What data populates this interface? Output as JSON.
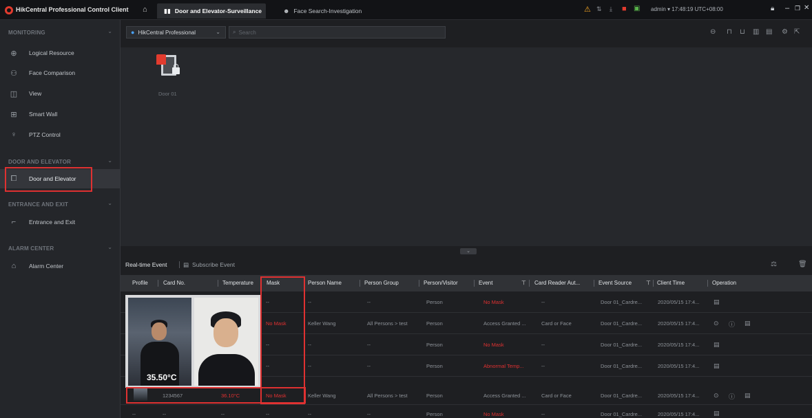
{
  "titlebar": {
    "app_title": "HikCentral Professional Control Client",
    "tabs": [
      {
        "label": "Door and Elevator-Surveillance",
        "active": true
      },
      {
        "label": "Face Search-Investigation",
        "active": false
      }
    ],
    "user": "admin",
    "time": "17:48:19 UTC+08:00"
  },
  "sidebar": {
    "sections": [
      {
        "label": "MONITORING",
        "items": [
          "Logical Resource",
          "Face Comparison",
          "View",
          "Smart Wall",
          "PTZ Control"
        ]
      },
      {
        "label": "DOOR AND ELEVATOR",
        "items": [
          "Door and Elevator"
        ]
      },
      {
        "label": "ENTRANCE AND EXIT",
        "items": [
          "Entrance and Exit"
        ]
      },
      {
        "label": "ALARM CENTER",
        "items": [
          "Alarm Center"
        ]
      }
    ]
  },
  "toolbar": {
    "site": "HikCentral Professional",
    "search_placeholder": "Search"
  },
  "canvas": {
    "door_label": "Door 01"
  },
  "events": {
    "tab_realtime": "Real-time Event",
    "tab_subscribe": "Subscribe Event",
    "columns": [
      "Profile",
      "Card No.",
      "Temperature",
      "Mask",
      "Person Name",
      "Person Group",
      "Person/Visitor",
      "Event",
      "Card Reader Aut...",
      "Event Source",
      "Client Time",
      "Operation"
    ],
    "rows": [
      {
        "card": "",
        "temp": "",
        "mask": "--",
        "name": "--",
        "group": "--",
        "pv": "Person",
        "event": "No Mask",
        "event_red": true,
        "reader": "--",
        "source": "Door 01_Cardre...",
        "time": "2020/05/15 17:4..."
      },
      {
        "card": "",
        "temp": "",
        "mask": "No Mask",
        "mask_red": true,
        "name": "Keller Wang",
        "group": "All Persons > test",
        "pv": "Person",
        "event": "Access Granted ...",
        "reader": "Card or Face",
        "source": "Door 01_Cardre...",
        "time": "2020/05/15 17:4..."
      },
      {
        "card": "",
        "temp": "",
        "mask": "--",
        "name": "--",
        "group": "--",
        "pv": "Person",
        "event": "No Mask",
        "event_red": true,
        "reader": "--",
        "source": "Door 01_Cardre...",
        "time": "2020/05/15 17:4..."
      },
      {
        "card": "",
        "temp": "",
        "mask": "--",
        "name": "--",
        "group": "--",
        "pv": "Person",
        "event": "Abnormal Temp...",
        "event_red": true,
        "reader": "--",
        "source": "Door 01_Cardre...",
        "time": "2020/05/15 17:4..."
      },
      {
        "card": "1234567",
        "temp": "36.10°C",
        "temp_red": true,
        "mask": "No Mask",
        "mask_red": true,
        "name": "Keller Wang",
        "group": "All Persons > test",
        "pv": "Person",
        "event": "Access Granted ...",
        "reader": "Card or Face",
        "source": "Door 01_Cardre...",
        "time": "2020/05/15 17:4..."
      },
      {
        "card": "--",
        "temp": "--",
        "mask": "--",
        "name": "--",
        "group": "--",
        "pv": "Person",
        "event": "No Mask",
        "event_red": true,
        "reader": "--",
        "source": "Door 01_Cardre...",
        "time": "2020/05/15 17:4..."
      }
    ]
  },
  "popup": {
    "temperature": "35.50°C"
  }
}
